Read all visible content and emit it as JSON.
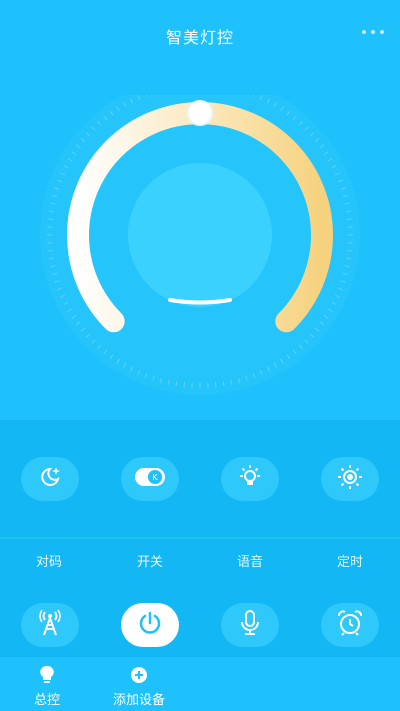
{
  "header": {
    "title": "智美灯控",
    "more_icon": "more-dots-icon"
  },
  "dial": {
    "brightness_level": 0.5,
    "colors": {
      "warm_end": "#f6d88a",
      "cool_end": "#ffffff",
      "inner": "#41d3ff",
      "outer": "#2fcafd"
    }
  },
  "modes": [
    {
      "icon": "moon-stars-icon"
    },
    {
      "icon": "toggle-k-icon"
    },
    {
      "icon": "bulb-icon"
    },
    {
      "icon": "sun-icon"
    }
  ],
  "labels": [
    "对码",
    "开关",
    "语音",
    "定时"
  ],
  "actions": [
    {
      "icon": "signal-tower-icon"
    },
    {
      "icon": "power-icon"
    },
    {
      "icon": "microphone-icon"
    },
    {
      "icon": "alarm-clock-icon"
    }
  ],
  "tabs": [
    {
      "label": "总控",
      "icon": "bulb-icon"
    },
    {
      "label": "添加设备",
      "icon": "add-circle-icon"
    }
  ]
}
